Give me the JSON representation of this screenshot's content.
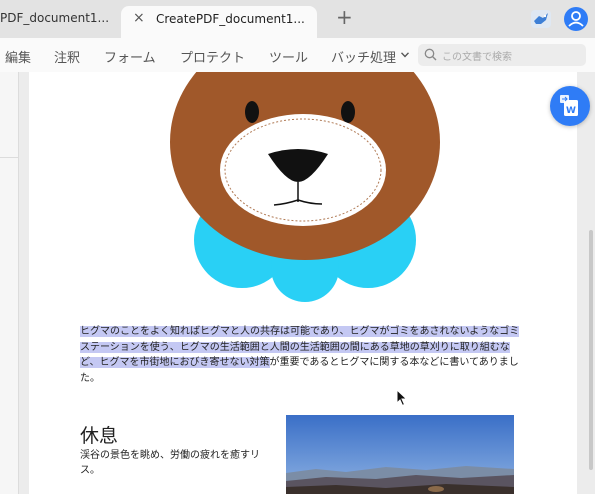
{
  "tabs": [
    {
      "title": "PDF_document1..."
    },
    {
      "title": "CreatePDF_document1...",
      "close": "×"
    }
  ],
  "new_tab": "+",
  "toolbar": {
    "items": [
      "編集",
      "注釈",
      "フォーム",
      "プロテクト",
      "ツール",
      "バッチ処理"
    ],
    "search_placeholder": "この文書で検索"
  },
  "document": {
    "paragraph": {
      "highlighted": "ヒグマのことをよく知ればヒグマと人の共存は可能であり、ヒグマがゴミをあされないようなゴミステーションを使う、ヒグマの生活範囲と人間の生活範囲の間にある草地の草刈りに取り組むなど、ヒグマを市街地におびき寄せない対策",
      "normal": "が重要であるとヒグマに関する本などに書いてありました。"
    },
    "heading": "休息",
    "body_text": "渓谷の景色を眺め、労働の疲れを癒すリス。"
  },
  "icons": [
    "close-icon",
    "plus-icon",
    "bird-icon",
    "user-icon",
    "chevron-down-icon",
    "search-icon",
    "word-convert-icon",
    "mouse-cursor-icon"
  ],
  "colors": {
    "accent": "#2f7cf6",
    "highlight": "#c4c8f3",
    "bear_brown": "#a0582a",
    "bow_cyan": "#29d0f5"
  }
}
